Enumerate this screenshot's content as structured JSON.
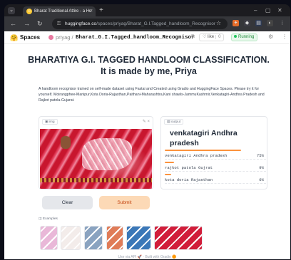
{
  "browser": {
    "tab_title": "Bharat Traditional Attire - a Hu",
    "tab_close": "×",
    "new_tab": "+",
    "url_host": "huggingface.co",
    "url_path": "/spaces/priyag/Bharat_G.I.Tagged_handloom_Recognisor",
    "icons": [
      "back-icon",
      "forward-icon",
      "reload-icon",
      "lock-icon",
      "bookmark-star-icon",
      "extension-icon",
      "menu-icon"
    ]
  },
  "spaces_bar": {
    "logo": "🤗",
    "spaces_label": "Spaces",
    "user": "priyag",
    "separator": "/",
    "repo": "Bharat_G.I.Tagged_handloom_Recognisor",
    "like_label": "♡ like",
    "like_count": "0",
    "status": "Running",
    "settings_icon": "⚙",
    "menu_icon": "⋮"
  },
  "main": {
    "title": "BHARATIYA G.I. TAGGED HANDLOOM CLASSIFICATION. It is made by me, Priya",
    "description": "A handloom recognisor trained on self-made dataset using Fastai and Created using Gradio and HuggingFace Spaces. Please try it for yourself. Moirangphee-Manipur,Kota Doria-Rajasthan,Paithani-Maharashtra,Kani shawls-JammuKashmir,Venkatagiri-Andhra Pradesh and Rajkot patola-Gujarat."
  },
  "input": {
    "label": "img",
    "tools": "✎ ×"
  },
  "buttons": {
    "clear": "Clear",
    "submit": "Submit"
  },
  "output": {
    "label": "output",
    "top_label": "venkatagiri Andhra pradesh",
    "confidences": [
      {
        "name": "venkatagiri Andhra pradesh",
        "pct_text": "75%",
        "value": 0.75
      },
      {
        "name": "rajkot patola Gujrat",
        "pct_text": "9%",
        "value": 0.09
      },
      {
        "name": "kota doria Rajasthan",
        "pct_text": "6%",
        "value": 0.06
      }
    ]
  },
  "examples": {
    "label": "Examples",
    "thumbs": [
      {
        "name": "example-kota-doria",
        "color": "#e9b8d8"
      },
      {
        "name": "example-paithani",
        "color": "#f3ecea"
      },
      {
        "name": "example-kani-shawl",
        "color": "#8aa3c0"
      },
      {
        "name": "example-rajkot-patola",
        "color": "#e07c58"
      },
      {
        "name": "example-moirangphee",
        "color": "#3b78b8"
      },
      {
        "name": "example-venkatagiri",
        "color": "#d11d3a"
      }
    ]
  },
  "footer": {
    "api": "Use via API 🚀",
    "sep": "·",
    "built": "Built with Gradio 🟠"
  }
}
